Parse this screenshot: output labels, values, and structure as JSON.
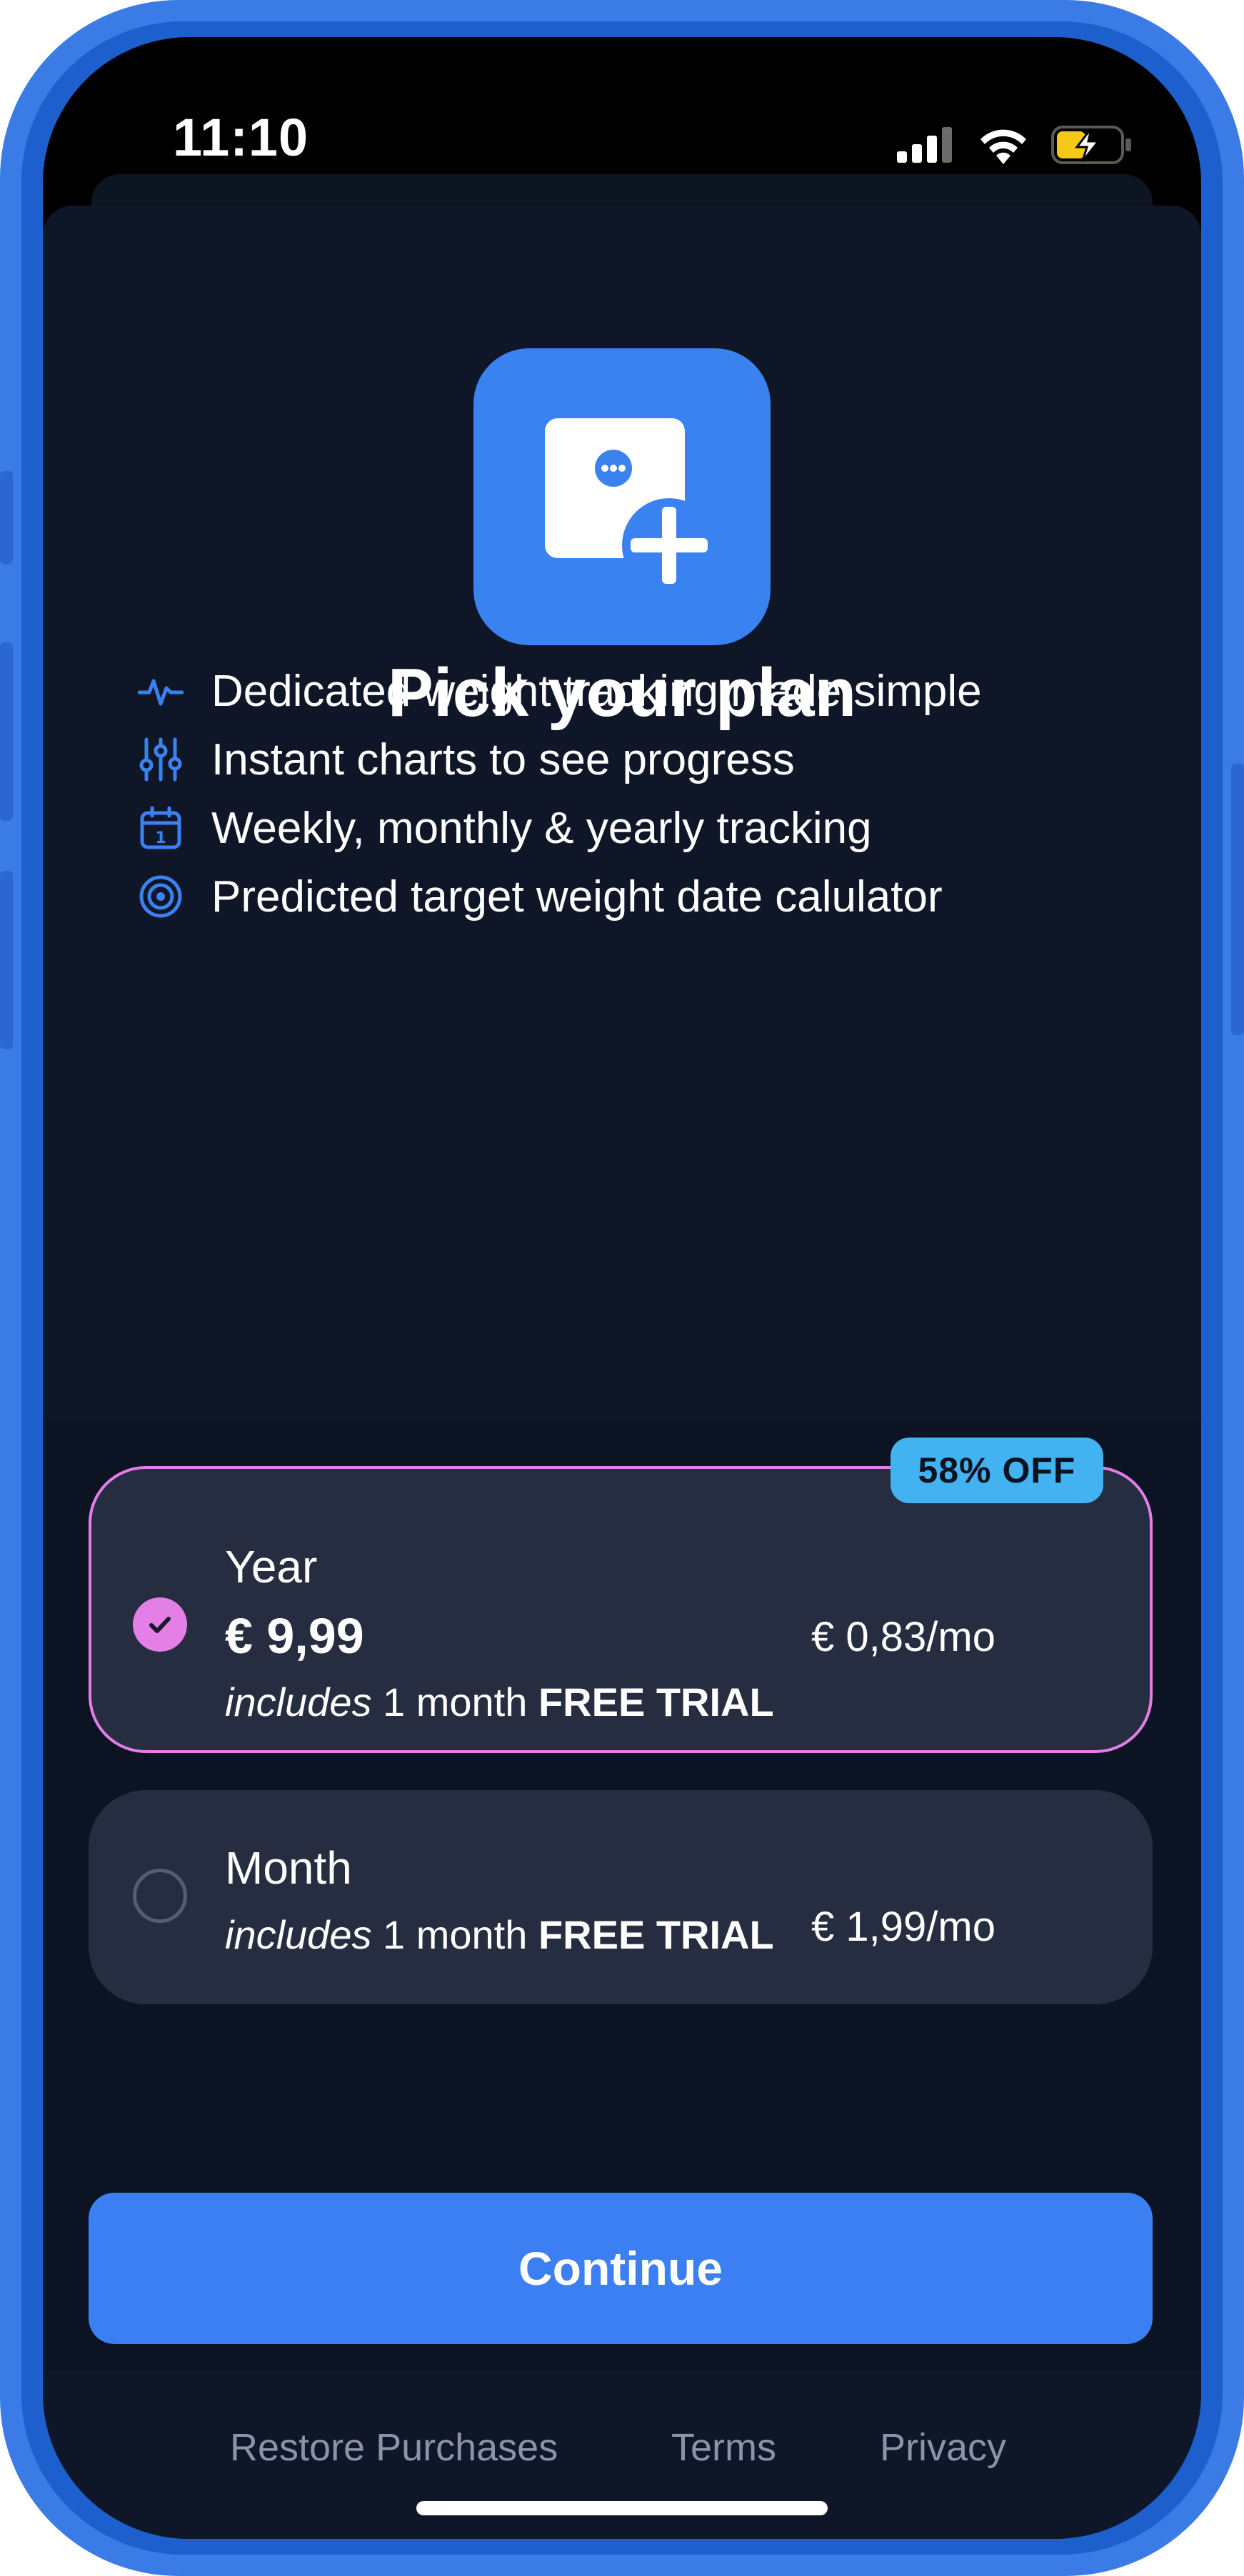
{
  "status_bar": {
    "time": "11:10",
    "icons": [
      "signal-icon",
      "wifi-icon",
      "battery-charging-icon"
    ]
  },
  "app": {
    "icon": "note-add-icon",
    "title": "Pick your plan"
  },
  "features": [
    {
      "icon": "pulse-icon",
      "text": "Dedicated weight tracking made simple"
    },
    {
      "icon": "sliders-icon",
      "text": "Instant charts to see progress"
    },
    {
      "icon": "calendar-icon",
      "text": "Weekly, monthly & yearly tracking"
    },
    {
      "icon": "target-icon",
      "text": "Predicted target weight date calulator"
    }
  ],
  "plans": [
    {
      "name": "Year",
      "price": "€ 9,99",
      "trial_prefix": "includes",
      "trial_middle": " 1 month ",
      "trial_suffix": "FREE TRIAL",
      "per_month": "€ 0,83/mo",
      "badge": "58% OFF",
      "selected": true
    },
    {
      "name": "Month",
      "trial_prefix": "includes",
      "trial_middle": " 1 month ",
      "trial_suffix": "FREE TRIAL",
      "per_month": "€ 1,99/mo",
      "selected": false
    }
  ],
  "actions": {
    "continue_label": "Continue"
  },
  "footer": {
    "restore": "Restore Purchases",
    "terms": "Terms",
    "privacy": "Privacy"
  },
  "colors": {
    "frame": "#3b7be6",
    "background": "#0f1628",
    "accent": "#3b7ff2",
    "selected": "#e57fe8",
    "badge": "#43b2f0"
  }
}
